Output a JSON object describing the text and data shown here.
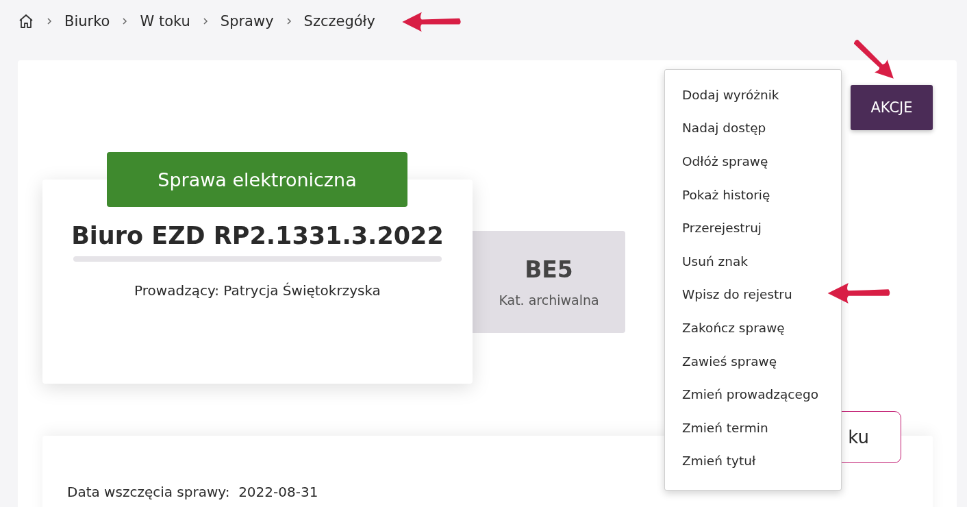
{
  "breadcrumb": [
    "Biurko",
    "W toku",
    "Sprawy",
    "Szczegóły"
  ],
  "actions_button": "AKCJE",
  "menu": [
    "Dodaj wyróżnik",
    "Nadaj dostęp",
    "Odłóż sprawę",
    "Pokaż historię",
    "Przerejestruj",
    "Usuń znak",
    "Wpisz do rejestru",
    "Zakończ sprawę",
    "Zawieś sprawę",
    "Zmień prowadzącego",
    "Zmień termin",
    "Zmień tytuł"
  ],
  "case": {
    "type_label": "Sprawa elektroniczna",
    "signature": "Biuro EZD RP2.1331.3.2022",
    "lead": "Prowadzący: Patrycja Świętokrzyska"
  },
  "archive": {
    "category": "BE5",
    "label": "Kat. archiwalna"
  },
  "partial_button": "ku",
  "details": [
    {
      "label": "Data wszczęcia sprawy:",
      "value": "2022-08-31"
    }
  ]
}
